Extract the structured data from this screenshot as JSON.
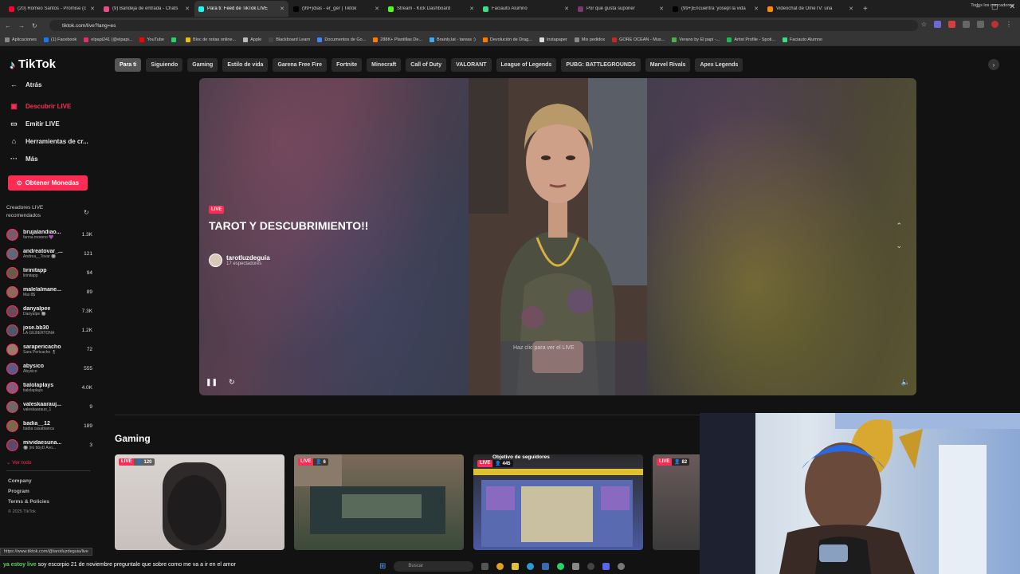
{
  "browser": {
    "tabs": [
      {
        "label": "(20) Romeo Santos - Promise (c",
        "color": "#ff0033"
      },
      {
        "label": "(9) Bandeja de entrada - Chats",
        "color": "#ea4c89"
      },
      {
        "label": "Para ti: Feed de TikTok LIVE",
        "color": "#25f4ee",
        "active": true
      },
      {
        "label": "(99+)dias - er_ger | Tiktok",
        "color": "#000000"
      },
      {
        "label": "Stream - Kick Dashboard",
        "color": "#53fc18"
      },
      {
        "label": "Faciauto Alumno",
        "color": "#3ddc84"
      },
      {
        "label": "Por qué gusta suponer",
        "color": "#7a3b6b"
      },
      {
        "label": "(99+)Encuentra 'yosepl la vida",
        "color": "#000000"
      },
      {
        "label": "Videochat de OmeTV: una",
        "color": "#ff8c00"
      }
    ],
    "new_tab": "+",
    "url": "tiktok.com/live?lang=es",
    "bookmarks": [
      {
        "label": "Aplicaciones",
        "color": "#888888"
      },
      {
        "label": "(1) Facebook",
        "color": "#1877f2"
      },
      {
        "label": "elpapi241 (@elpapi...",
        "color": "#e1306c"
      },
      {
        "label": "YouTube",
        "color": "#ff0000"
      },
      {
        "label": "",
        "color": "#25d366"
      },
      {
        "label": "Bloc de notas online...",
        "color": "#f0c000"
      },
      {
        "label": "Apple",
        "color": "#bbbbbb"
      },
      {
        "label": "Blackboard Learn",
        "color": "#444444"
      },
      {
        "label": "Documentos de Go...",
        "color": "#4285f4"
      },
      {
        "label": "288K+ Plantillas De...",
        "color": "#ff7a00"
      },
      {
        "label": "Brainly.lat - tareas :)",
        "color": "#3ea9f5"
      },
      {
        "label": "Devolución de Drag...",
        "color": "#ff7a00"
      },
      {
        "label": "Instapaper",
        "color": "#dddddd"
      },
      {
        "label": "Mis pedidos",
        "color": "#888888"
      },
      {
        "label": "GORE OCEAN - Mus...",
        "color": "#c62828"
      },
      {
        "label": "Verano by El papi -...",
        "color": "#4caf50"
      },
      {
        "label": "Artist Profile - Spoti...",
        "color": "#1db954"
      },
      {
        "label": "Faciauto Alumno",
        "color": "#3ddc84"
      }
    ],
    "bookmarks_right": "Todos los marcadores"
  },
  "sidebar": {
    "logo": "TikTok",
    "nav": [
      {
        "label": "Atrás",
        "icon": "back-arrow-icon",
        "glyph": "←"
      },
      {
        "label": "Descubrir LIVE",
        "icon": "live-discover-icon",
        "glyph": "▣",
        "active": true
      },
      {
        "label": "Emitir LIVE",
        "icon": "camera-icon",
        "glyph": "▭"
      },
      {
        "label": "Herramientas de cr...",
        "icon": "home-tools-icon",
        "glyph": "⌂"
      },
      {
        "label": "Más",
        "icon": "more-dots-icon",
        "glyph": "···"
      }
    ],
    "coins_button": "Obtener Monedas",
    "creators_title": "Creadores LIVE recomendados",
    "creators": [
      {
        "name": "brujalandiao...",
        "sub": "fanna moreno 💜",
        "count": "1.3K",
        "color": "#7a5a6a"
      },
      {
        "name": "andreatovar_...",
        "sub": "Andrea__Tovar 🔘",
        "count": "121",
        "color": "#5a6a7a"
      },
      {
        "name": "lirinitapp",
        "sub": "lirinitapp",
        "count": "94",
        "color": "#6a5a4a"
      },
      {
        "name": "malelalmane...",
        "sub": "Mai 8$",
        "count": "89",
        "color": "#8a6a5a"
      },
      {
        "name": "danyalpee",
        "sub": "Danyalpe 🔘",
        "count": "7.3K",
        "color": "#6a4a5a"
      },
      {
        "name": "jose.bb30",
        "sub": "LA GILBERTOÑA",
        "count": "1.2K",
        "color": "#4a5a6a"
      },
      {
        "name": "sarapericacho",
        "sub": "Sara Pericacho 🎖",
        "count": "72",
        "color": "#9a7a6a"
      },
      {
        "name": "abysico",
        "sub": "Abysico",
        "count": "555",
        "color": "#5a5a8a"
      },
      {
        "name": "tialolaplays",
        "sub": "tialolaplays",
        "count": "4.0K",
        "color": "#8a5a7a"
      },
      {
        "name": "valeskaarauj...",
        "sub": "valeskaarauo_1",
        "count": "9",
        "color": "#6a6a6a"
      },
      {
        "name": "badia__12",
        "sub": "badia casablanca",
        "count": "189",
        "color": "#7a6a4a"
      },
      {
        "name": "mividaesuna...",
        "sub": "🔘 |mi bbyD Avo...",
        "count": "3",
        "color": "#5a4a6a"
      }
    ],
    "see_all": "⌄ Ver todo",
    "footer": [
      "Company",
      "Program",
      "Terms & Policies"
    ],
    "copyright": "© 2025 TikTok"
  },
  "categories": [
    "Para ti",
    "Siguiendo",
    "Gaming",
    "Estilo de vida",
    "Garena Free Fire",
    "Fortnite",
    "Minecraft",
    "Call of Duty",
    "VALORANT",
    "League of Legends",
    "PUBG: BATTLEGROUNDS",
    "Marvel Rivals",
    "Apex Legends"
  ],
  "featured": {
    "badge": "LIVE",
    "title": "TAROT Y DESCUBRIMIENTO!!",
    "host": "tarotluzdeguia",
    "viewers": "17 espectadores",
    "overlay_link": "Haz clic para ver el LIVE"
  },
  "gaming": {
    "title": "Gaming",
    "items": [
      {
        "badge": "LIVE",
        "viewers": "120",
        "goal": ""
      },
      {
        "badge": "LIVE",
        "viewers": "6",
        "goal": ""
      },
      {
        "badge": "LIVE",
        "viewers": "445",
        "goal": "Objetivo de seguidores"
      },
      {
        "badge": "LIVE",
        "viewers": "82",
        "goal": ""
      }
    ]
  },
  "status_url": "https://www.tiktok.com/@tarotluzdeguia/live",
  "chat": {
    "user": "ya estoy live",
    "message": "soy escorpio 21 de noviembre preguntale que sobre como me va a ir en el amor"
  },
  "taskbar": {
    "search_placeholder": "Buscar"
  }
}
